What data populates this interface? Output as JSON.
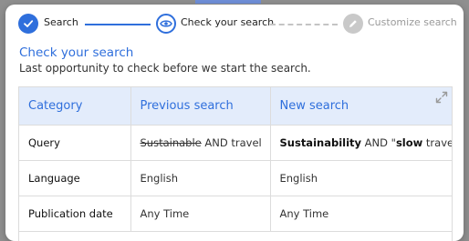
{
  "stepper": {
    "steps": [
      {
        "label": "Search",
        "state": "done",
        "icon": "check-icon"
      },
      {
        "label": "Check your search",
        "state": "active",
        "icon": "eye-icon"
      },
      {
        "label": "Customize search",
        "state": "todo",
        "icon": "pencil-icon"
      }
    ]
  },
  "heading": {
    "title": "Check your search",
    "subtitle": "Last opportunity to check before we start the search."
  },
  "table": {
    "headers": [
      "Category",
      "Previous search",
      "New search"
    ],
    "expand_icon": "expand-icon",
    "rows": [
      {
        "category": "Query",
        "previous": {
          "strikethrough": "Sustainable",
          "rest": " AND travel"
        },
        "new": {
          "part1": "Sustainability",
          "part2": " AND \"",
          "part3": "slow",
          "part4": " travel\""
        }
      },
      {
        "category": "Language",
        "previous": "English",
        "new": "English"
      },
      {
        "category": "Publication date",
        "previous": "Any Time",
        "new": "Any Time"
      }
    ]
  },
  "colors": {
    "accent": "#2f6fdc",
    "header_bg": "#e3ecfb",
    "todo_gray": "#c9c9c9"
  }
}
